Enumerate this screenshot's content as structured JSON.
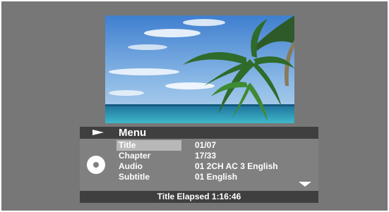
{
  "menu": {
    "title": "Menu",
    "items": [
      {
        "label": "Title",
        "value": "01/07",
        "selected": true
      },
      {
        "label": "Chapter",
        "value": "17/33",
        "selected": false
      },
      {
        "label": "Audio",
        "value": "01 2CH AC 3 English",
        "selected": false
      },
      {
        "label": "Subtitle",
        "value": "01 English",
        "selected": false
      }
    ]
  },
  "status": {
    "text": "Title Elapsed  1:16:46"
  },
  "icons": {
    "play": "play-icon",
    "disc": "disc-icon",
    "scroll_down": "down-arrow-icon"
  },
  "colors": {
    "background": "#777777",
    "header_bar": "#3f3f3f",
    "panel": "#808080",
    "selection": "#b8b8b8",
    "text": "#ffffff"
  }
}
